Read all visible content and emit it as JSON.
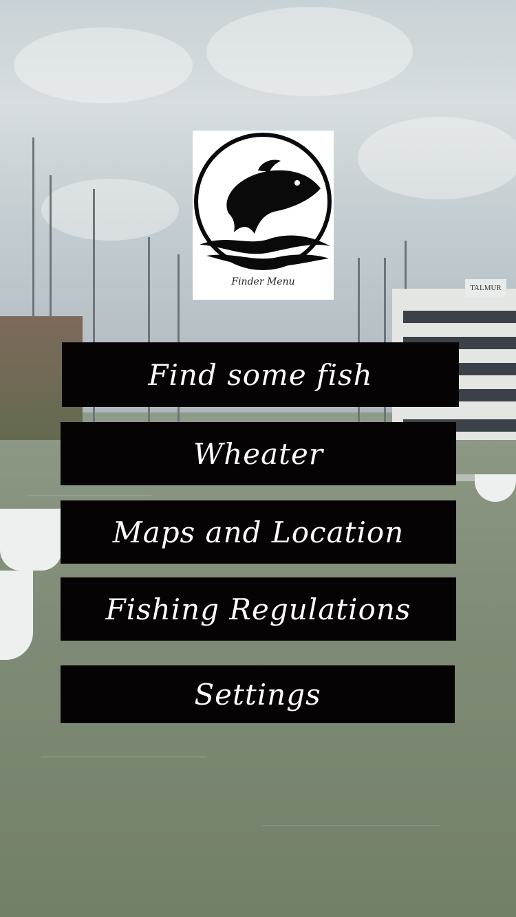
{
  "logo": {
    "icon": "fish-icon",
    "caption": "Finder Menu"
  },
  "background": {
    "sign_text": "TALMUR"
  },
  "menu": {
    "items": [
      {
        "label": "Find some fish"
      },
      {
        "label": "Wheater"
      },
      {
        "label": "Maps and Location"
      },
      {
        "label": "Fishing Regulations"
      },
      {
        "label": "Settings"
      }
    ]
  },
  "colors": {
    "button_bg": "#060304",
    "button_text": "#ffffff"
  }
}
